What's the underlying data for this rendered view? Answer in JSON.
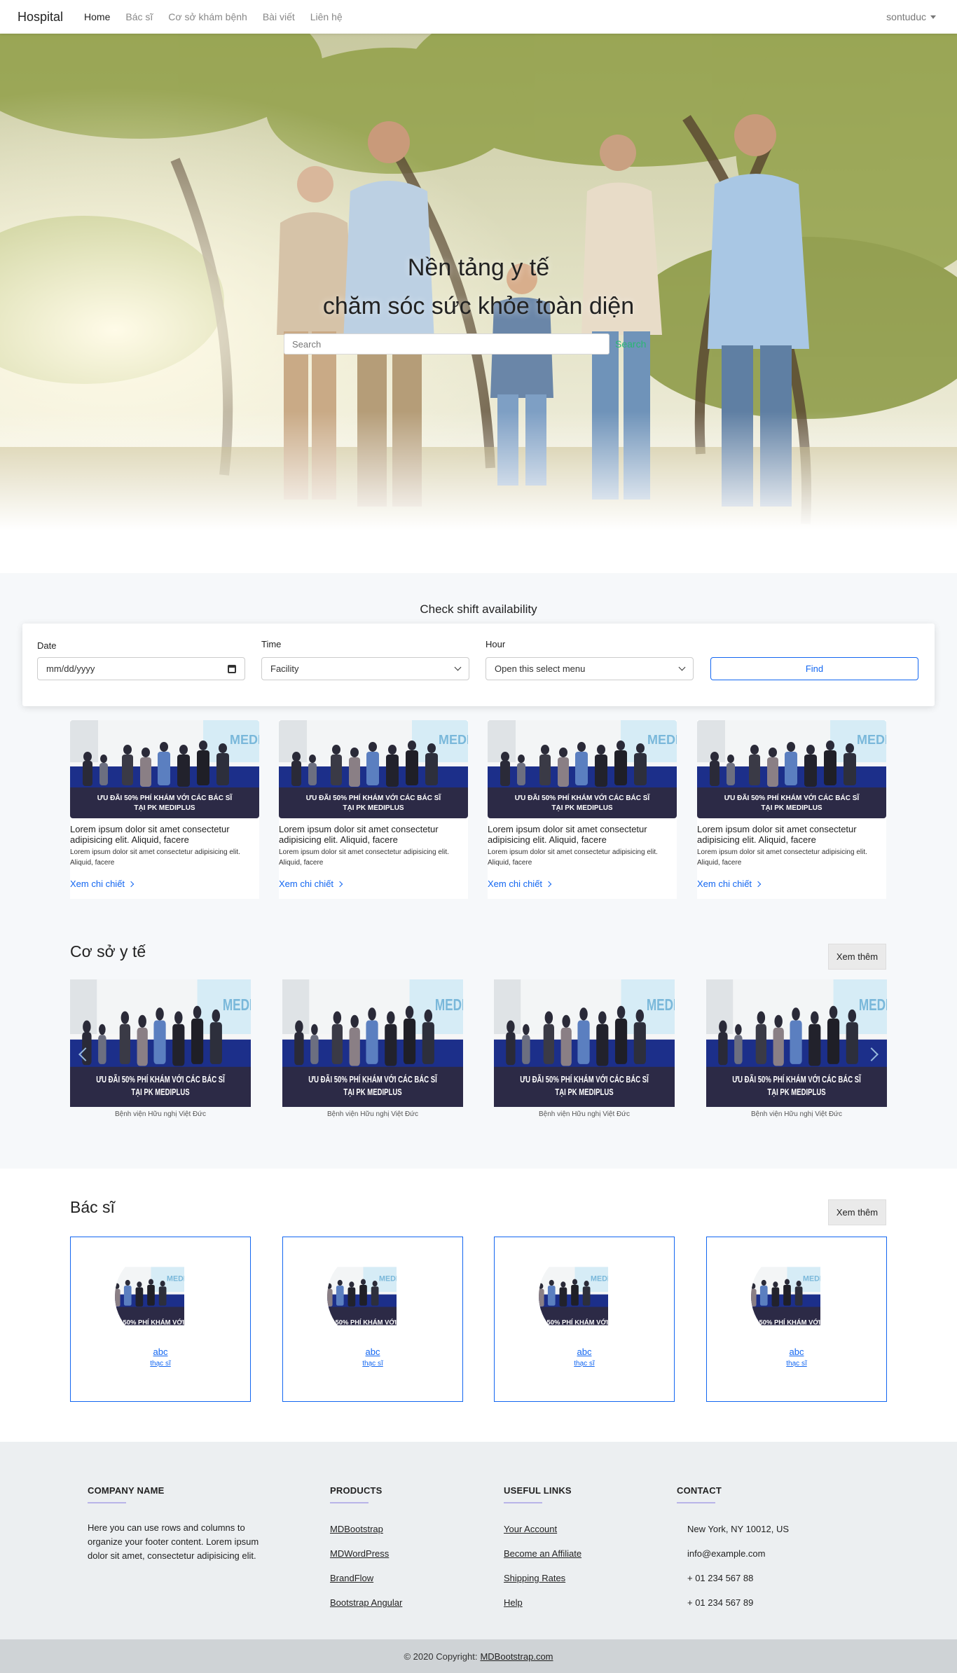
{
  "navbar": {
    "brand": "Hospital",
    "links": [
      "Home",
      "Bác sĩ",
      "Cơ sở khám bệnh",
      "Bài viết",
      "Liên hệ"
    ],
    "user": "sontuduc"
  },
  "hero": {
    "title_line1": "Nền tảng y tế",
    "title_line2": "chăm sóc sức khỏe toàn diện",
    "search_placeholder": "Search",
    "search_button": "Search"
  },
  "shift": {
    "heading": "Check shift availability",
    "date_label": "Date",
    "date_value": "mm/dd/yyyy",
    "time_label": "Time",
    "time_value": "Facility",
    "hour_label": "Hour",
    "hour_value": "Open this select menu",
    "find_button": "Find"
  },
  "banner": {
    "line1": "ƯU ĐÃI 50% PHÍ KHÁM VỚI CÁC BÁC SĨ",
    "line2": "TẠI PK MEDIPLUS",
    "brand": "MEDI"
  },
  "news": [
    {
      "title": "Lorem ipsum dolor sit amet consectetur adipisicing elit. Aliquid, facere",
      "text": "Lorem ipsum dolor sit amet consectetur adipisicing elit. Aliquid, facere",
      "link": "Xem chi chiết"
    },
    {
      "title": "Lorem ipsum dolor sit amet consectetur adipisicing elit. Aliquid, facere",
      "text": "Lorem ipsum dolor sit amet consectetur adipisicing elit. Aliquid, facere",
      "link": "Xem chi chiết"
    },
    {
      "title": "Lorem ipsum dolor sit amet consectetur adipisicing elit. Aliquid, facere",
      "text": "Lorem ipsum dolor sit amet consectetur adipisicing elit. Aliquid, facere",
      "link": "Xem chi chiết"
    },
    {
      "title": "Lorem ipsum dolor sit amet consectetur adipisicing elit. Aliquid, facere",
      "text": "Lorem ipsum dolor sit amet consectetur adipisicing elit. Aliquid, facere",
      "link": "Xem chi chiết"
    }
  ],
  "facilities": {
    "title": "Cơ sở y tế",
    "more_button": "Xem thêm",
    "items": [
      {
        "name": "Bệnh viện Hữu nghị Việt Đức"
      },
      {
        "name": "Bệnh viện Hữu nghị Việt Đức"
      },
      {
        "name": "Bệnh viện Hữu nghị Việt Đức"
      },
      {
        "name": "Bệnh viện Hữu nghị Việt Đức"
      }
    ]
  },
  "doctors": {
    "title": "Bác sĩ",
    "more_button": "Xem thêm",
    "items": [
      {
        "name": "abc",
        "title": "thạc sĩ"
      },
      {
        "name": "abc",
        "title": "thạc sĩ"
      },
      {
        "name": "abc",
        "title": "thạc sĩ"
      },
      {
        "name": "abc",
        "title": "thạc sĩ"
      }
    ]
  },
  "footer": {
    "company": {
      "heading": "COMPANY NAME",
      "text": "Here you can use rows and columns to organize your footer content. Lorem ipsum dolor sit amet, consectetur adipisicing elit."
    },
    "products": {
      "heading": "PRODUCTS",
      "links": [
        "MDBootstrap",
        "MDWordPress",
        "BrandFlow",
        "Bootstrap Angular"
      ]
    },
    "useful": {
      "heading": "USEFUL LINKS",
      "links": [
        "Your Account",
        "Become an Affiliate",
        "Shipping Rates",
        "Help"
      ]
    },
    "contact": {
      "heading": "CONTACT",
      "items": [
        "New York, NY 10012, US",
        "info@example.com",
        "+ 01 234 567 88",
        "+ 01 234 567 89"
      ]
    },
    "copyright_text": "© 2020 Copyright:",
    "copyright_link": "MDBootstrap.com"
  },
  "colors": {
    "accent": "#1266f1",
    "search_green": "#2bb673",
    "footer_bg": "#eceff1",
    "copyright_bg": "#cfd3d6"
  }
}
